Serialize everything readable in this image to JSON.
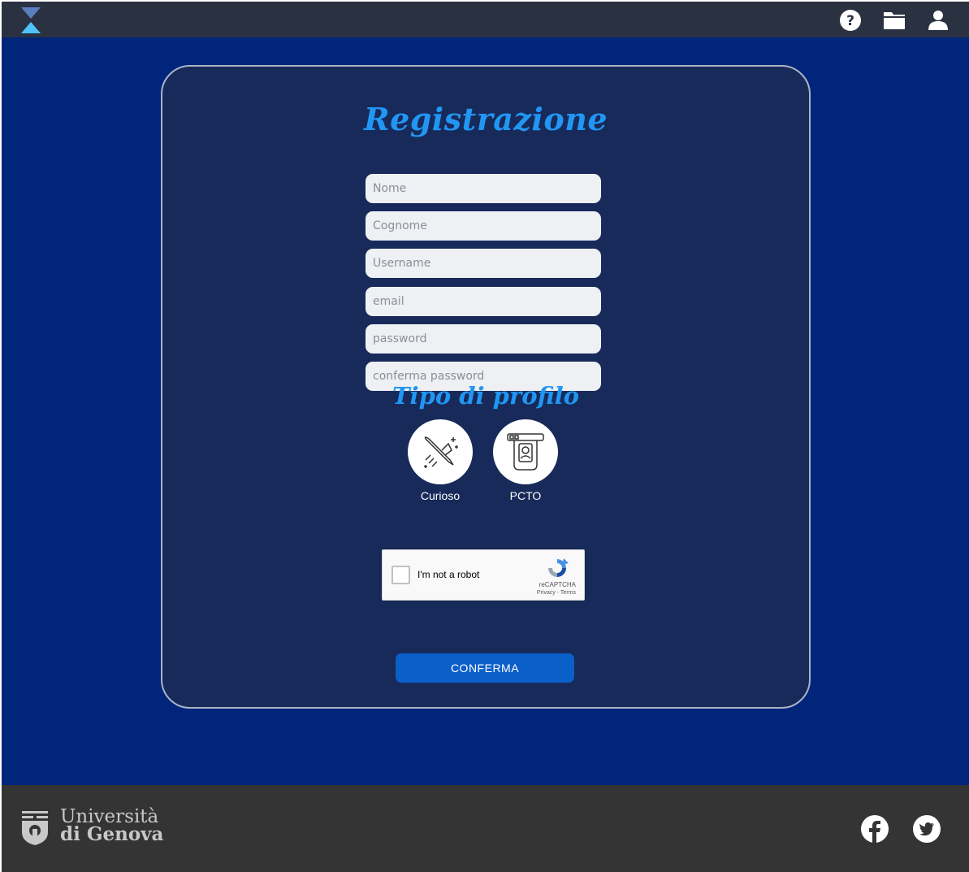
{
  "header": {
    "logo_icon": "hourglass-logo-icon",
    "icons": [
      "help-icon",
      "folder-icon",
      "user-icon"
    ]
  },
  "form": {
    "title": "Registrazione",
    "fields": [
      {
        "name": "nome",
        "placeholder": "Nome",
        "value": ""
      },
      {
        "name": "cognome",
        "placeholder": "Cognome",
        "value": ""
      },
      {
        "name": "username",
        "placeholder": "Username",
        "value": ""
      },
      {
        "name": "email",
        "placeholder": "email",
        "value": ""
      },
      {
        "name": "password",
        "placeholder": "password",
        "value": ""
      },
      {
        "name": "conferma-password",
        "placeholder": "conferma password",
        "value": ""
      }
    ],
    "profile_title": "Tipo di profilo",
    "profiles": [
      {
        "label": "Curioso",
        "icon": "rocket-icon"
      },
      {
        "label": "PCTO",
        "icon": "atm-card-icon"
      }
    ],
    "captcha": {
      "label": "I'm not a robot",
      "brand": "reCAPTCHA",
      "links": "Privacy - Terms"
    },
    "confirm_label": "CONFERMA"
  },
  "footer": {
    "university_line1": "Università",
    "university_line2": "di Genova",
    "social_icons": [
      "facebook-icon",
      "twitter-icon"
    ]
  },
  "colors": {
    "topbar": "#2a3141",
    "page_background": "#00257a",
    "card": "#172a5a",
    "accent": "#2196f3",
    "button": "#0b5fc9",
    "footer": "#343434"
  }
}
